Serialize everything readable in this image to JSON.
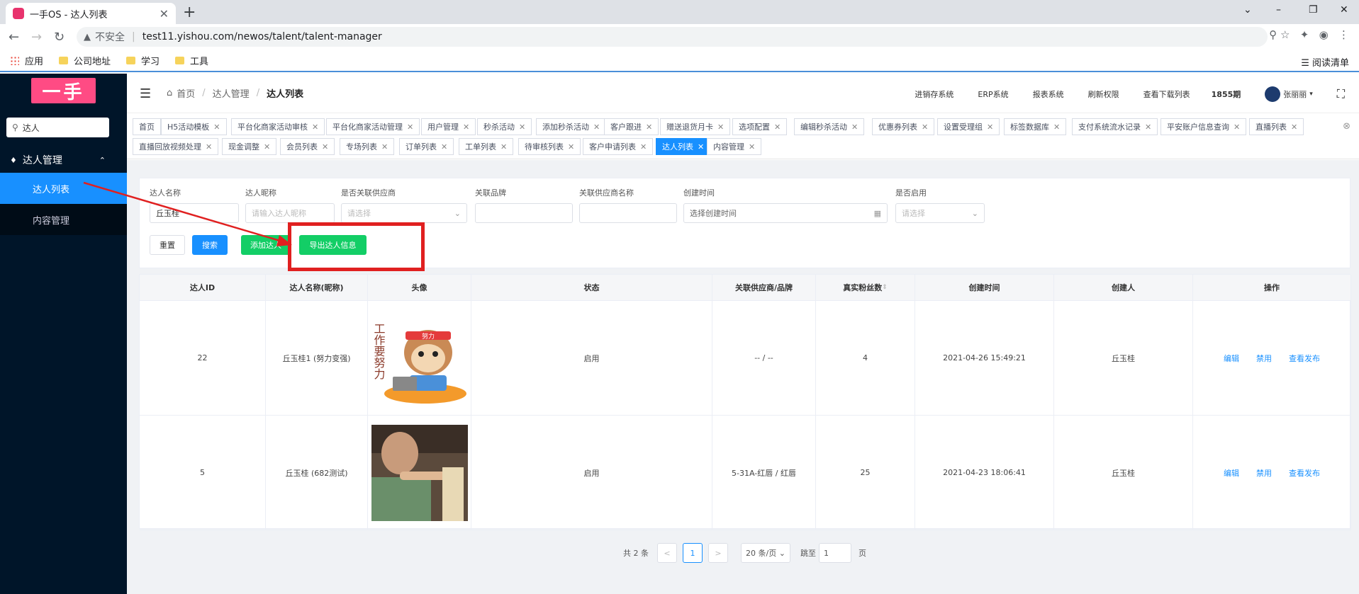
{
  "browser": {
    "tab_title": "一手OS - 达人列表",
    "new_tab": "+",
    "insecure_label": "不安全",
    "url": "test11.yishou.com/newos/talent/talent-manager",
    "bookmarks": [
      {
        "label": "应用"
      },
      {
        "label": "公司地址"
      },
      {
        "label": "学习"
      },
      {
        "label": "工具"
      }
    ],
    "reading_list": "阅读清单"
  },
  "sidebar": {
    "logo": "一手",
    "search_value": "达人",
    "group_label": "达人管理",
    "items": [
      {
        "label": "达人列表",
        "active": true
      },
      {
        "label": "内容管理",
        "active": false
      }
    ]
  },
  "header": {
    "breadcrumb": [
      "首页",
      "达人管理",
      "达人列表"
    ],
    "links": [
      "进销存系统",
      "ERP系统",
      "报表系统",
      "刷新权限",
      "查看下载列表",
      "1855期"
    ],
    "user": "张丽丽"
  },
  "tags": [
    "首页",
    "H5活动模板",
    "平台化商家活动审核",
    "平台化商家活动管理",
    "用户管理",
    "秒杀活动",
    "添加秒杀活动",
    "客户跟进",
    "赠送退货月卡",
    "选项配置",
    "编辑秒杀活动",
    "优惠券列表",
    "设置受理组",
    "标签数据库",
    "支付系统流水记录",
    "平安账户信息查询",
    "直播列表",
    "直播回放视频处理",
    "现金调整",
    "会员列表",
    "专场列表",
    "订单列表",
    "工单列表",
    "待审核列表",
    "客户申请列表",
    "达人列表",
    "内容管理"
  ],
  "filter": {
    "talent_name_label": "达人名称",
    "talent_name_value": "丘玉桂",
    "nickname_label": "达人昵称",
    "nickname_placeholder": "请输入达人昵称",
    "supplier_linked_label": "是否关联供应商",
    "supplier_linked_placeholder": "请选择",
    "brand_label": "关联品牌",
    "supplier_name_label": "关联供应商名称",
    "created_label": "创建时间",
    "created_placeholder": "选择创建时间",
    "enabled_label": "是否启用",
    "enabled_placeholder": "请选择",
    "reset": "重置",
    "search": "搜索",
    "add": "添加达人",
    "export": "导出达人信息"
  },
  "table": {
    "columns": [
      "达人ID",
      "达人名称(昵称)",
      "头像",
      "状态",
      "关联供应商/品牌",
      "真实粉丝数",
      "创建时间",
      "创建人",
      "操作"
    ],
    "rows": [
      {
        "id": "22",
        "name": "丘玉桂1 (努力变强)",
        "avatar_text": "工作要努力",
        "avatar_badge": "努力",
        "status": "启用",
        "supplier": "-- / --",
        "fans": "4",
        "created": "2021-04-26 15:49:21",
        "creator": "丘玉桂"
      },
      {
        "id": "5",
        "name": "丘玉桂 (682测试)",
        "status": "启用",
        "supplier": "5-31A-红唇 / 红唇",
        "fans": "25",
        "created": "2021-04-23 18:06:41",
        "creator": "丘玉桂"
      }
    ],
    "ops": [
      "编辑",
      "禁用",
      "查看发布"
    ]
  },
  "pager": {
    "total": "共 2 条",
    "prev": "<",
    "current": "1",
    "next": ">",
    "page_size": "20 条/页",
    "goto_label": "跳至",
    "goto_value": "1",
    "page_unit": "页"
  },
  "colors": {
    "primary": "#1890ff",
    "success": "#13ce66",
    "sidebar": "#001529",
    "logo": "#ff4b84",
    "annotation": "#e02020"
  }
}
